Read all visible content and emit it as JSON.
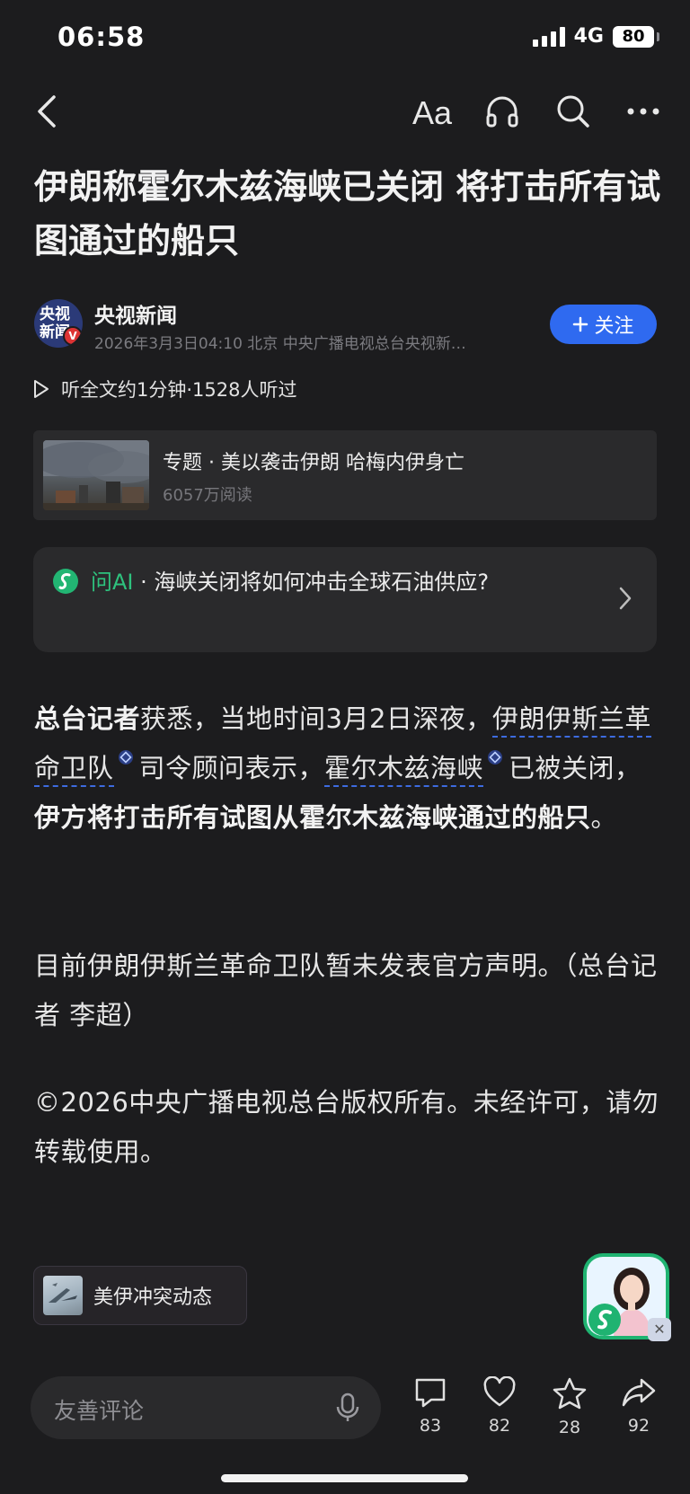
{
  "status_bar": {
    "time": "06:58",
    "network": "4G",
    "battery": "80"
  },
  "article": {
    "title": "伊朗称霍尔木兹海峡已关闭 将打击所有试图通过的船只",
    "author": {
      "name": "央视新闻",
      "avatar_text": "央视新闻",
      "meta": "2026年3月3日04:10 北京 中央广播电视总台央视新…",
      "follow_label": "关注"
    },
    "listen_label": "听全文约1分钟·1528人听过",
    "topic": {
      "title": "专题 · 美以袭击伊朗 哈梅内伊身亡",
      "reads": "6057万阅读"
    },
    "ai_card": {
      "label": "问AI",
      "question": " · 海峡关闭将如何冲击全球石油供应?"
    },
    "paragraph1": {
      "lead": "总台记者",
      "text1": "获悉，当地时间3月2日深夜，",
      "link1": "伊朗伊斯兰革命卫队",
      "text2": "司令顾问表示，",
      "link2": "霍尔木兹海峡",
      "text3": "已被关闭，",
      "emphasis": "伊方将打击所有试图从霍尔木兹海峡通过的船只",
      "end": "。"
    },
    "paragraph2": "目前伊朗伊斯兰革命卫队暂未发表官方声明。（总台记者 李超）",
    "paragraph3": "©2026中央广播电视总台版权所有。未经许可，请勿转载使用。"
  },
  "floating_tag": {
    "label": "美伊冲突动态"
  },
  "bottom_bar": {
    "comment_placeholder": "友善评论",
    "comments": "83",
    "likes": "82",
    "favorites": "28",
    "shares": "92"
  },
  "colors": {
    "background": "#1c1c1e",
    "accent_blue": "#2f6af0",
    "ai_green": "#2ec27e",
    "link_underline": "#3d6be0"
  },
  "icons": [
    "back-icon",
    "font-size-icon",
    "headphones-icon",
    "search-icon",
    "more-icon",
    "play-icon",
    "chevron-right-icon",
    "mic-icon",
    "comment-icon",
    "heart-icon",
    "star-icon",
    "share-icon"
  ]
}
